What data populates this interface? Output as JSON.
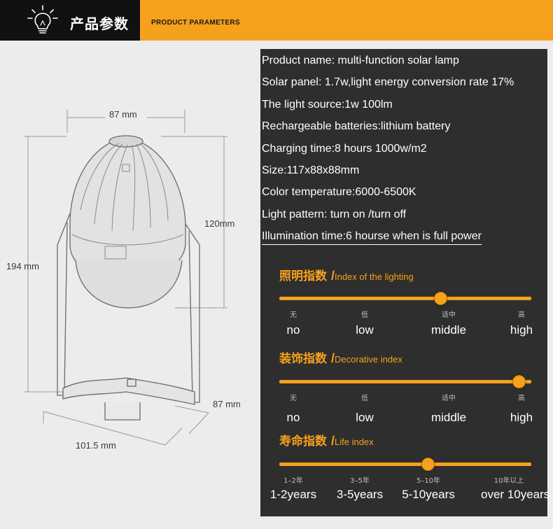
{
  "header": {
    "title_cn": "产品参数",
    "title_en": "PRODUCT PARAMETERS"
  },
  "drawing": {
    "dim_top_width": "87 mm",
    "dim_height_head": "120mm",
    "dim_total_height": "194 mm",
    "dim_base_depth": "87 mm",
    "dim_base_width": "101.5 mm"
  },
  "specs": [
    "Product name: multi-function solar lamp",
    "Solar panel: 1.7w,light energy conversion rate 17%",
    "The light source:1w 100lm",
    "Rechargeable batteries:lithium battery",
    "Charging time:8 hours 1000w/m2",
    "Size:117x88x88mm",
    "Color temperature:6000-6500K",
    "Light pattern: turn on /turn off",
    "Illumination time:6 hourse when  is full power"
  ],
  "indexes": [
    {
      "title_cn": "照明指数",
      "slash": "/",
      "title_en": "Index of the lighting",
      "value_fraction": 0.64,
      "levels": [
        {
          "cn": "无",
          "en": "no"
        },
        {
          "cn": "低",
          "en": "low"
        },
        {
          "cn": "适中",
          "en": "middle"
        },
        {
          "cn": "高",
          "en": "high"
        }
      ]
    },
    {
      "title_cn": "装饰指数",
      "slash": "/",
      "title_en": "Decorative index",
      "value_fraction": 0.95,
      "levels": [
        {
          "cn": "无",
          "en": "no"
        },
        {
          "cn": "低",
          "en": "low"
        },
        {
          "cn": "适中",
          "en": "middle"
        },
        {
          "cn": "高",
          "en": "high"
        }
      ]
    },
    {
      "title_cn": "寿命指数",
      "slash": "/",
      "title_en": "Life index",
      "value_fraction": 0.59,
      "levels": [
        {
          "cn": "1–2年",
          "en": "1-2years"
        },
        {
          "cn": "3–5年",
          "en": "3-5years"
        },
        {
          "cn": "5–10年",
          "en": "5-10years"
        },
        {
          "cn": "10年以上",
          "en": "over  10years"
        }
      ]
    }
  ],
  "colors": {
    "accent": "#f5a11c",
    "header_dark": "#111111",
    "panel_bg": "#2e2e2e",
    "page_bg": "#ececec"
  },
  "icons": {
    "header": "lightbulb-icon"
  }
}
